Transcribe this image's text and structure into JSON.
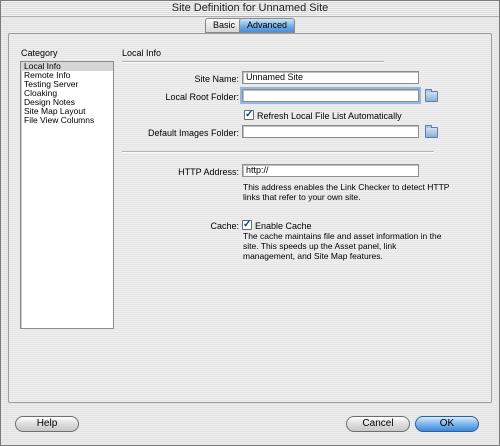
{
  "window": {
    "title": "Site Definition for Unnamed Site"
  },
  "tabs": [
    {
      "label": "Basic",
      "active": false
    },
    {
      "label": "Advanced",
      "active": true
    }
  ],
  "category": {
    "label": "Category",
    "items": [
      "Local Info",
      "Remote Info",
      "Testing Server",
      "Cloaking",
      "Design Notes",
      "Site Map Layout",
      "File View Columns"
    ],
    "selected": "Local Info"
  },
  "local_info": {
    "section_title": "Local Info",
    "site_name_label": "Site Name:",
    "site_name_value": "Unnamed Site",
    "local_root_label": "Local Root Folder:",
    "local_root_value": "",
    "refresh_label": "Refresh Local File List Automatically",
    "refresh_checked": true,
    "default_images_label": "Default Images Folder:",
    "default_images_value": "",
    "http_label": "HTTP Address:",
    "http_value": "http://",
    "http_help": "This address enables the Link Checker to detect HTTP links that refer to your own site.",
    "cache_label": "Cache:",
    "cache_checkbox_label": "Enable Cache",
    "cache_checked": true,
    "cache_help": "The cache maintains file and asset information in the site.  This speeds up the Asset panel, link management, and Site Map features."
  },
  "buttons": {
    "help": "Help",
    "cancel": "Cancel",
    "ok": "OK"
  },
  "icons": {
    "folder": "folder-icon",
    "checkmark": "checkmark-icon"
  },
  "colors": {
    "accent": "#4b8fd6"
  }
}
